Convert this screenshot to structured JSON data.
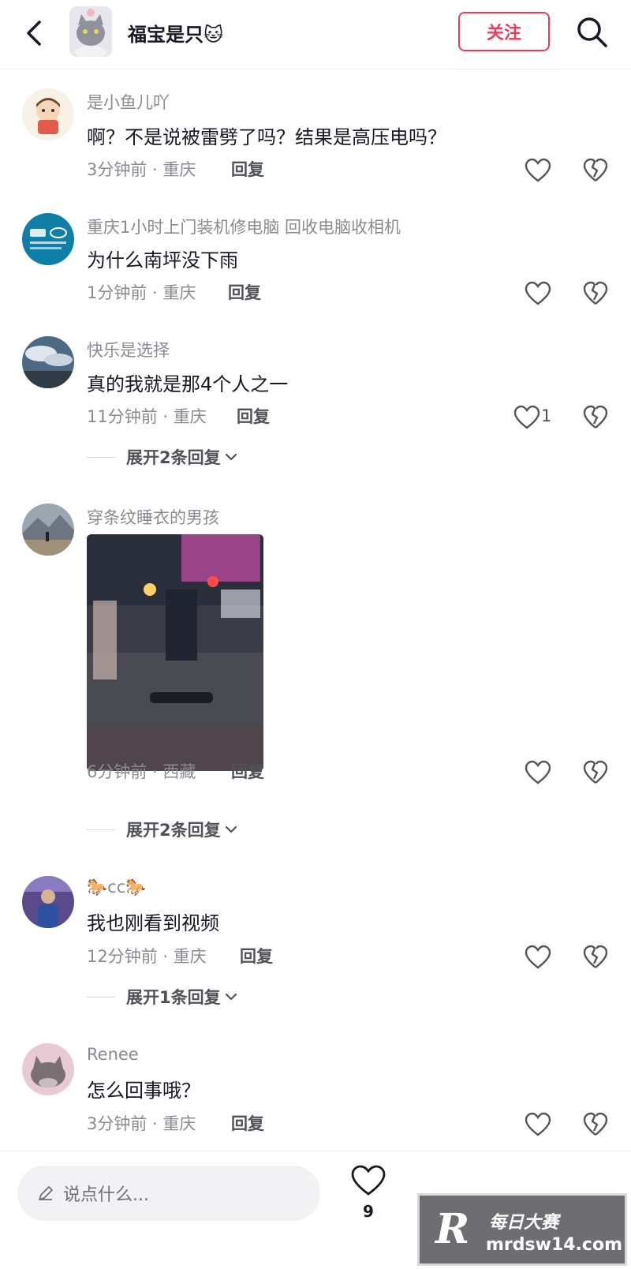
{
  "header": {
    "title": "福宝是只🐱",
    "follow_label": "关注"
  },
  "comments": [
    {
      "username": "是小鱼儿吖",
      "text": "啊？不是说被雷劈了吗？结果是高压电吗？",
      "time_location": "3分钟前 · 重庆",
      "reply_label": "回复",
      "avatar_icon": "cartoon-boy-avatar"
    },
    {
      "username": "重庆1小时上门装机修电脑 回收电脑收相机",
      "text": "为什么南坪没下雨",
      "time_location": "1分钟前 · 重庆",
      "reply_label": "回复",
      "avatar_icon": "shop-logo-avatar"
    },
    {
      "username": "快乐是选择",
      "text": "真的我就是那4个人之一",
      "time_location": "11分钟前 · 重庆",
      "reply_label": "回复",
      "like_count": "1",
      "expand_label": "展开2条回复",
      "avatar_icon": "sky-landscape-avatar"
    },
    {
      "username": "穿条纹睡衣的男孩",
      "time_location": "6分钟前 · 西藏",
      "reply_label": "回复",
      "expand_label": "展开2条回复",
      "avatar_icon": "mountain-person-avatar",
      "photo_icon": "flooded-street-photo"
    },
    {
      "username": "🐎cc🐎",
      "text": "我也刚看到视频",
      "time_location": "12分钟前 · 重庆",
      "reply_label": "回复",
      "expand_label": "展开1条回复",
      "avatar_icon": "person-photo-avatar"
    },
    {
      "username": "Renee",
      "text": "怎么回事哦？",
      "time_location": "3分钟前 · 重庆",
      "reply_label": "回复",
      "avatar_icon": "cat-photo-avatar"
    }
  ],
  "bottom_bar": {
    "input_placeholder": "说点什么...",
    "like_count": "9"
  },
  "watermark": {
    "logo": "R",
    "name": "每日大赛",
    "url": "mrdsw14.com"
  },
  "colors": {
    "accent": "#e33f5a",
    "text_primary": "#161823",
    "text_secondary": "#8a8b91"
  }
}
